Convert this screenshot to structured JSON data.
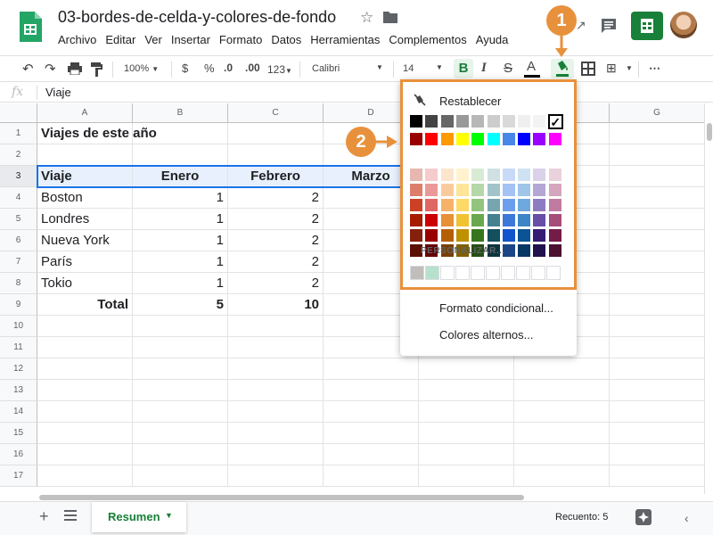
{
  "title_bar": {
    "doc_title": "03-bordes-de-celda-y-colores-de-fondo",
    "menu": [
      "Archivo",
      "Editar",
      "Ver",
      "Insertar",
      "Formato",
      "Datos",
      "Herramientas",
      "Complementos",
      "Ayuda"
    ]
  },
  "toolbar": {
    "zoom": "100%",
    "currency": "$",
    "percent": "%",
    "dec_less": ".0",
    "dec_more": ".00",
    "more_formats": "123",
    "font": "Calibri",
    "font_size": "14",
    "bold": "B",
    "italic": "I",
    "strike": "S",
    "text_color": "A",
    "more": "⋯"
  },
  "formula_bar": {
    "fx": "fx",
    "value": "Viaje"
  },
  "columns": [
    "A",
    "B",
    "C",
    "D",
    "E",
    "F",
    "G"
  ],
  "rows": [
    "1",
    "2",
    "3",
    "4",
    "5",
    "6",
    "7",
    "8",
    "9",
    "10",
    "11",
    "12",
    "13",
    "14",
    "15",
    "16",
    "17"
  ],
  "sheet": {
    "title": "Viajes de este año",
    "headers": [
      "Viaje",
      "Enero",
      "Febrero",
      "Marzo"
    ],
    "data": [
      [
        "Boston",
        "1",
        "2"
      ],
      [
        "Londres",
        "1",
        "2"
      ],
      [
        "Nueva York",
        "1",
        "2"
      ],
      [
        "París",
        "1",
        "2"
      ],
      [
        "Tokio",
        "1",
        "2"
      ]
    ],
    "total_label": "Total",
    "totals": [
      "5",
      "10"
    ]
  },
  "fill_popup": {
    "reset": "Restablecer",
    "custom": "PERSONALIZAR...",
    "conditional": "Formato condicional...",
    "alternating": "Colores alternos...",
    "selected_color_index": 7,
    "palette": [
      [
        "#000000",
        "#434343",
        "#666666",
        "#999999",
        "#b7b7b7",
        "#cccccc",
        "#d9d9d9",
        "#efefef",
        "#f3f3f3",
        "#ffffff"
      ],
      [
        "#980000",
        "#ff0000",
        "#ff9900",
        "#ffff00",
        "#00ff00",
        "#00ffff",
        "#4a86e8",
        "#0000ff",
        "#9900ff",
        "#ff00ff"
      ],
      [
        "#e6b8af",
        "#f4cccc",
        "#fce5cd",
        "#fff2cc",
        "#d9ead3",
        "#d0e0e3",
        "#c9daf8",
        "#cfe2f3",
        "#d9d2e9",
        "#ead1dc"
      ],
      [
        "#dd7e6b",
        "#ea9999",
        "#f9cb9c",
        "#ffe599",
        "#b6d7a8",
        "#a2c4c9",
        "#a4c2f4",
        "#9fc5e8",
        "#b4a7d6",
        "#d5a6bd"
      ],
      [
        "#cc4125",
        "#e06666",
        "#f6b26b",
        "#ffd966",
        "#93c47d",
        "#76a5af",
        "#6d9eeb",
        "#6fa8dc",
        "#8e7cc3",
        "#c27ba0"
      ],
      [
        "#a61c00",
        "#cc0000",
        "#e69138",
        "#f1c232",
        "#6aa84f",
        "#45818e",
        "#3c78d8",
        "#3d85c6",
        "#674ea7",
        "#a64d79"
      ],
      [
        "#85200c",
        "#990000",
        "#b45f06",
        "#bf9000",
        "#38761d",
        "#134f5c",
        "#1155cc",
        "#0b5394",
        "#351c75",
        "#741b47"
      ],
      [
        "#5b0f00",
        "#660000",
        "#783f04",
        "#7f6000",
        "#274e13",
        "#0c343d",
        "#1c4587",
        "#073763",
        "#20124d",
        "#4c1130"
      ]
    ],
    "custom_colors": [
      "#c0bdbb",
      "#b7e1cd",
      "#ffffff",
      "#ffffff",
      "#ffffff",
      "#ffffff",
      "#ffffff",
      "#ffffff",
      "#ffffff",
      "#ffffff"
    ]
  },
  "callouts": [
    "1",
    "2"
  ],
  "sheet_tabs": {
    "active": "Resumen"
  },
  "status": {
    "count": "Recuento: 5"
  },
  "colors": {
    "accent_green": "#188038",
    "callout_orange": "#e8913c",
    "selection_blue": "#1a73e8",
    "header_fill": "#e8f0fe"
  }
}
